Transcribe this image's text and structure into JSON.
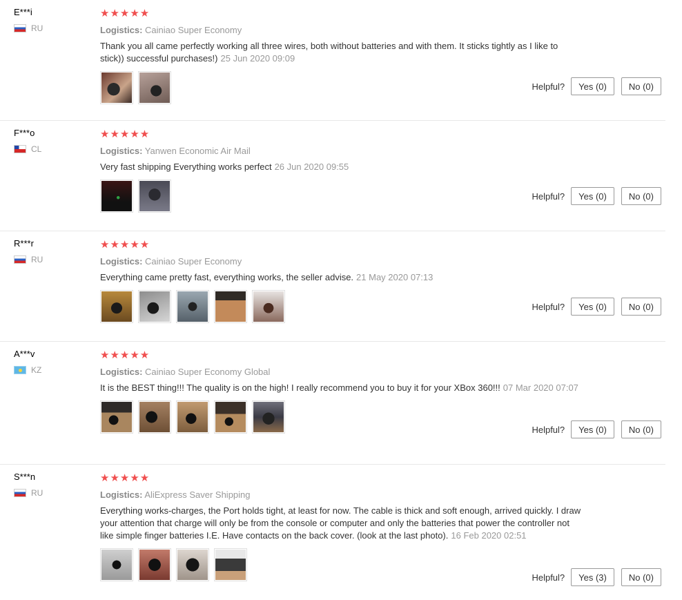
{
  "reviews": [
    {
      "user": "E***i",
      "country": "RU",
      "stars": "★★★★★",
      "logistics_label": "Logistics:",
      "logistics": "Cainiao Super Economy",
      "text": "Thank you all came perfectly working all three wires, both without batteries and with them. It sticks tightly as I like to stick)) successful purchases!)",
      "date": "25 Jun 2020 09:09",
      "helpful_label": "Helpful?",
      "yes": "Yes (0)",
      "no": "No (0)"
    },
    {
      "user": "F***o",
      "country": "CL",
      "stars": "★★★★★",
      "logistics_label": "Logistics:",
      "logistics": "Yanwen Economic Air Mail",
      "text": "Very fast shipping Everything works perfect",
      "date": "26 Jun 2020 09:55",
      "helpful_label": "Helpful?",
      "yes": "Yes (0)",
      "no": "No (0)"
    },
    {
      "user": "R***r",
      "country": "RU",
      "stars": "★★★★★",
      "logistics_label": "Logistics:",
      "logistics": "Cainiao Super Economy",
      "text": "Everything came pretty fast, everything works, the seller advise.",
      "date": "21 May 2020 07:13",
      "helpful_label": "Helpful?",
      "yes": "Yes (0)",
      "no": "No (0)"
    },
    {
      "user": "A***v",
      "country": "KZ",
      "stars": "★★★★★",
      "logistics_label": "Logistics:",
      "logistics": "Cainiao Super Economy Global",
      "text": "It is the BEST thing!!! The quality is on the high! I really recommend you to buy it for your XBox 360!!!",
      "date": "07 Mar 2020 07:07",
      "helpful_label": "Helpful?",
      "yes": "Yes (0)",
      "no": "No (0)"
    },
    {
      "user": "S***n",
      "country": "RU",
      "stars": "★★★★★",
      "logistics_label": "Logistics:",
      "logistics": "AliExpress Saver Shipping",
      "text": "Everything works-charges, the Port holds tight, at least for now. The cable is thick and soft enough, arrived quickly. I draw your attention that charge will only be from the console or computer and only the batteries that power the controller not like simple finger batteries I.E. Have contacts on the back cover. (look at the last photo).",
      "date": "16 Feb 2020 02:51",
      "helpful_label": "Helpful?",
      "yes": "Yes (3)",
      "no": "No (0)"
    }
  ]
}
